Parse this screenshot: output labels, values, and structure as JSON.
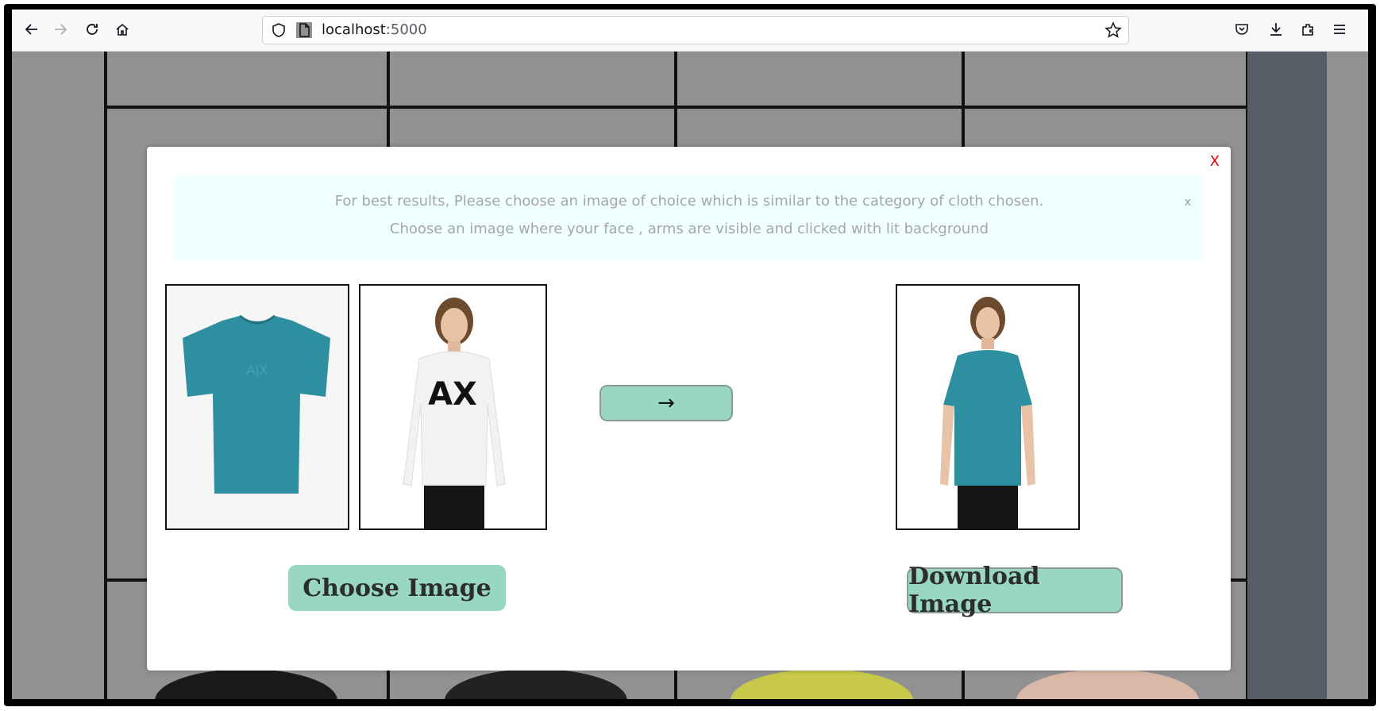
{
  "browser": {
    "url_host": "localhost",
    "url_port": ":5000",
    "icons": [
      "back-icon",
      "forward-icon",
      "reload-icon",
      "home-icon",
      "shield-icon",
      "page-icon",
      "bookmark-star-icon",
      "pocket-icon",
      "download-icon",
      "extensions-icon",
      "menu-icon"
    ]
  },
  "modal": {
    "close_label": "X",
    "notice": {
      "line1": "For best results, Please choose an image of choice which is similar to the category of cloth chosen.",
      "line2": "Choose an image where your face , arms are visible and clicked with lit background",
      "dismiss_label": "x"
    },
    "arrow_label": "→",
    "choose_button": "Choose Image",
    "download_button": "Download Image",
    "tshirt_text": "A|X",
    "model_shirt_text": "AX",
    "colors": {
      "accent": "#97d7c4",
      "tshirt": "#2e8fa0",
      "close": "#e00000",
      "notice_bg": "#f0ffff"
    }
  }
}
